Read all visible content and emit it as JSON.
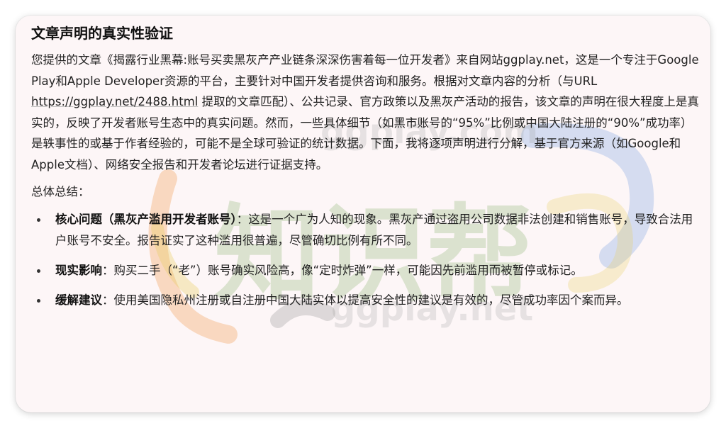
{
  "article": {
    "title": "文章声明的真实性验证",
    "intro_before_url": "您提供的文章《揭露行业黑幕:账号买卖黑灰产产业链条深深伤害着每一位开发者》来自网站ggplay.net，这是一个专注于Google Play和Apple Developer资源的平台，主要针对中国开发者提供咨询和服务。根据对文章内容的分析（与URL ",
    "intro_url": "https://ggplay.net/2488.html",
    "intro_after_url": " 提取的文章匹配）、公共记录、官方政策以及黑灰产活动的报告，该文章的声明在很大程度上是真实的，反映了开发者账号生态中的真实问题。然而，一些具体细节（如黑市账号的“95%”比例或中国大陆注册的“90%”成功率）是轶事性的或基于作者经验的，可能不是全球可验证的统计数据。下面，我将逐项声明进行分解，基于官方来源（如Google和Apple文档）、网络安全报告和开发者论坛进行证据支持。",
    "summary_label": "总体总结：",
    "points": [
      {
        "label": "核心问题（黑灰产滥用开发者账号）",
        "text": "：这是一个广为人知的现象。黑灰产通过盗用公司数据非法创建和销售账号，导致合法用户账号不安全。报告证实了这种滥用很普遍，尽管确切比例有所不同。"
      },
      {
        "label": "现实影响",
        "text": "：购买二手（“老”）账号确实风险高，像“定时炸弹”一样，可能因先前滥用而被暂停或标记。"
      },
      {
        "label": "缓解建议",
        "text": "：使用美国隐私州注册或自注册中国大陆实体以提高安全性的建议是有效的，尽管成功率因个案而异。"
      }
    ]
  },
  "watermark": {
    "brand_text": "知识帮",
    "domain_text_1": "ggplay.com",
    "domain_text_2": "ggplay.net",
    "colors": {
      "green": "#9dbf86",
      "orange": "#f2a15a",
      "blue": "#6f9be0",
      "yellow": "#e9cf62",
      "gray": "#8c8c8c"
    }
  }
}
